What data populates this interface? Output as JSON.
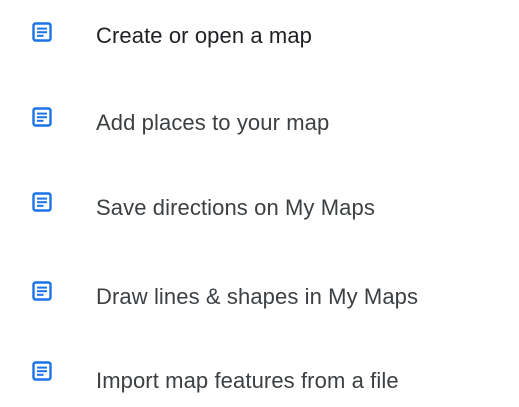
{
  "colors": {
    "icon": "#1a73e8",
    "text_primary": "#202124",
    "text_secondary": "#3c4043"
  },
  "help_list": {
    "items": [
      {
        "icon": "article-icon",
        "label": "Create or open a map"
      },
      {
        "icon": "article-icon",
        "label": "Add places to your map"
      },
      {
        "icon": "article-icon",
        "label": "Save directions on My Maps"
      },
      {
        "icon": "article-icon",
        "label": "Draw lines & shapes in My Maps"
      },
      {
        "icon": "article-icon",
        "label": "Import map features from a file"
      }
    ]
  }
}
